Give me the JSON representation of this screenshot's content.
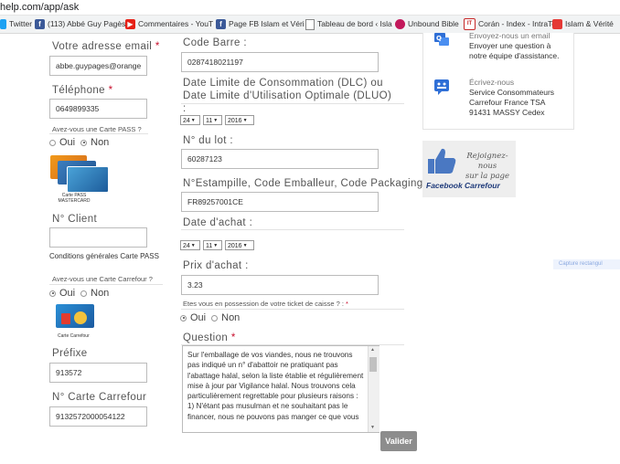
{
  "browser": {
    "url": "help.com/app/ask",
    "bookmarks": [
      {
        "label": "Twitter",
        "icon": "twitter-icon",
        "color": "#1da1f2"
      },
      {
        "label": "(113) Abbé Guy Pagès",
        "icon": "facebook-icon",
        "color": "#3b5998"
      },
      {
        "label": "Commentaires - YouT",
        "icon": "youtube-icon",
        "color": "#e62117"
      },
      {
        "label": "Page FB Islam et Véri",
        "icon": "facebook-icon",
        "color": "#3b5998"
      },
      {
        "label": "Tableau de bord ‹ Isla",
        "icon": "page-icon",
        "color": "#ffffff"
      },
      {
        "label": "Unbound Bible",
        "icon": "globe-icon",
        "color": "#c2185b"
      },
      {
        "label": "Corán - Index - IntraTe",
        "icon": "book-icon",
        "color": "#c62828"
      },
      {
        "label": "Islam & Vérité",
        "icon": "site-icon",
        "color": "#e53935"
      }
    ]
  },
  "left": {
    "email_label": "Votre adresse email",
    "email_value": "abbe.guypages@orange",
    "phone_label": "Téléphone",
    "phone_value": "0649899335",
    "pass_question": "Avez-vous une Carte PASS ?",
    "oui": "Oui",
    "non": "Non",
    "pass_card_caption_1": "Carte PASS",
    "pass_card_caption_2": "MASTERCARD",
    "client_label": "N° Client",
    "client_value": "",
    "conditions": "Conditions générales Carte PASS",
    "carrefour_question": "Avez-vous une Carte Carrefour ?",
    "carrefour_card_caption": "Carte Carrefour",
    "prefix_label": "Préfixe",
    "prefix_value": "913572",
    "carte_label": "N° Carte Carrefour",
    "carte_value": "9132572000054122"
  },
  "middle": {
    "barcode_label": "Code Barre :",
    "barcode_value": "0287418021197",
    "dlc_label": "Date Limite de Consommation (DLC) ou Date Limite d'Utilisation Optimale (DLUO) :",
    "dlc_day": "24",
    "dlc_month": "11",
    "dlc_year": "2016",
    "lot_label": "N° du lot :",
    "lot_value": "60287123",
    "estampille_label": "N°Estampille, Code Emballeur, Code Packaging :",
    "estampille_value": "FR89257001CE",
    "achat_date_label": "Date d'achat :",
    "achat_day": "24",
    "achat_month": "11",
    "achat_year": "2016",
    "prix_label": "Prix d'achat :",
    "prix_value": "3.23",
    "ticket_question": "Etes vous en possession de votre ticket de caisse ? :",
    "question_label": "Question",
    "question_text": "Sur l'emballage de vos viandes, nous ne trouvons pas indiqué un n° d'abattoir ne pratiquant pas l'abattage halal, selon la liste établie et régulièrement mise à jour par Vigilance halal. Nous trouvons cela particulièrement regrettable pour plusieurs raisons : 1) N'étant pas musulman et ne souhaitant pas le financer, nous ne pouvons pas manger ce que vous",
    "submit": "Valider"
  },
  "right": {
    "email_title": "Envoyez-nous un email",
    "email_desc_1": "Envoyer une question à",
    "email_desc_2": "notre équipe d'assistance.",
    "write_title": "Écrivez-nous",
    "write_line_1": "Service Consommateurs",
    "write_line_2": "Carrefour France TSA",
    "write_line_3": "91431 MASSY Cedex",
    "fb_join_1": "Rejoignez-nous",
    "fb_join_2": "sur la page",
    "fb_brand": "Facebook Carrefour",
    "capture": "Capture rectangul"
  }
}
